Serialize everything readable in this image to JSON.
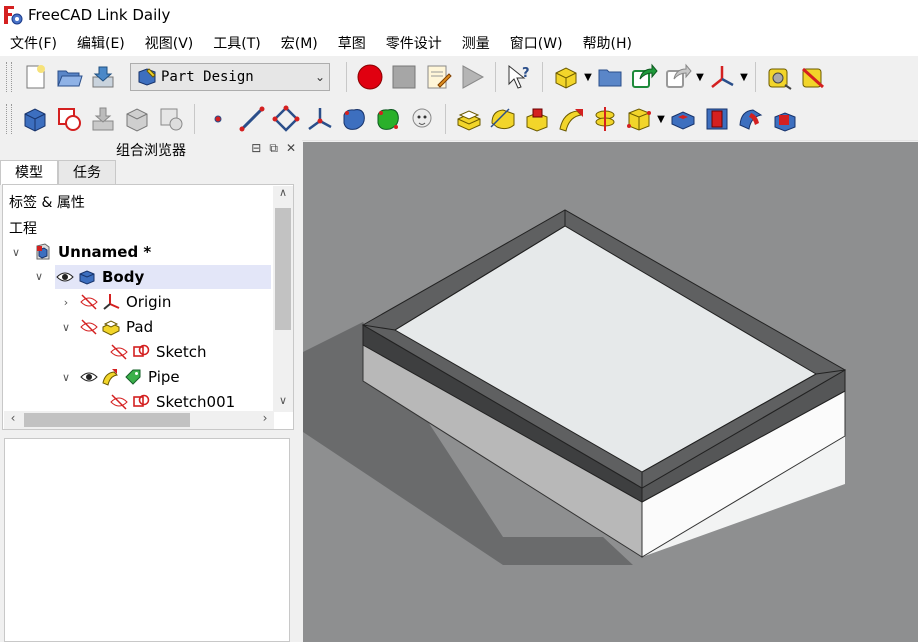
{
  "window": {
    "title": "FreeCAD Link Daily",
    "app_icon": "freecad-logo-icon"
  },
  "menu": [
    "文件(F)",
    "编辑(E)",
    "视图(V)",
    "工具(T)",
    "宏(M)",
    "草图",
    "零件设计",
    "测量",
    "窗口(W)",
    "帮助(H)"
  ],
  "toolbar1": {
    "workbench_selector": "Part Design",
    "buttons": [
      "new-document-icon",
      "open-document-icon",
      "save-document-icon",
      "macro-record-icon",
      "macro-stop-icon",
      "macro-edit-icon",
      "macro-run-icon",
      "whats-this-icon",
      "create-part-icon",
      "create-group-icon",
      "create-link-icon",
      "link-actions-icon",
      "datum-cs-icon",
      "measure-icon",
      "measure-clear-icon"
    ]
  },
  "toolbar2": {
    "buttons": [
      "create-body-icon",
      "create-sketch-icon",
      "validate-sketch-icon",
      "shape-binder-icon",
      "subshape-binder-icon",
      "datum-point-icon",
      "datum-line-icon",
      "datum-plane-icon",
      "local-cs-icon",
      "clone-icon",
      "additive-loft-icon",
      "sheep-clone-icon",
      "pad-icon",
      "revolution-icon",
      "additive-loft-tool-icon",
      "additive-pipe-icon",
      "additive-helix-icon",
      "additive-box-icon",
      "pocket-icon",
      "hole-icon",
      "groove-icon",
      "subtractive-loft-icon"
    ]
  },
  "combo_view": {
    "title": "组合浏览器",
    "tabs": [
      "模型",
      "任务"
    ],
    "tree": {
      "header1": "标签 & 属性",
      "header2": "工程",
      "items": [
        {
          "label": "Unnamed *",
          "bold": true
        },
        {
          "label": "Body",
          "bold": true
        },
        {
          "label": "Origin"
        },
        {
          "label": "Pad"
        },
        {
          "label": "Sketch"
        },
        {
          "label": "Pipe"
        },
        {
          "label": "Sketch001"
        }
      ]
    }
  },
  "colors": {
    "viewport_bg": "#8e8f90",
    "selection": "#e3e6f8",
    "accent_red": "#d42020",
    "accent_yellow": "#f2d52a"
  }
}
